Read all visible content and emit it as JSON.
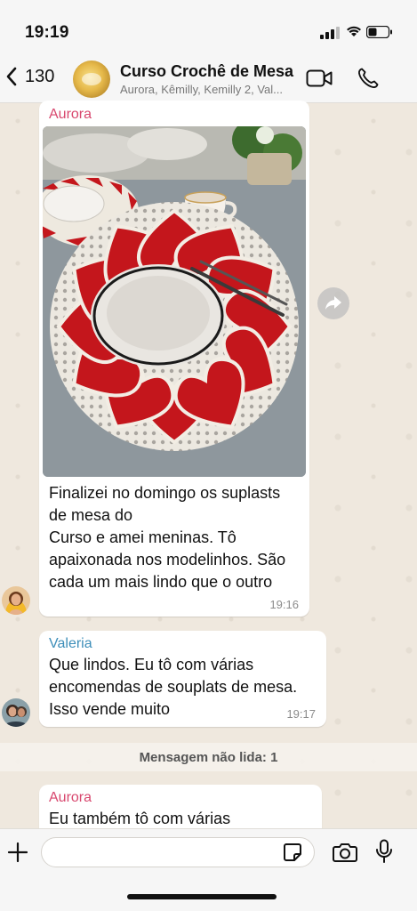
{
  "status_bar": {
    "time": "19:19"
  },
  "header": {
    "back_count": "130",
    "title": "Curso Crochê de Mesa",
    "members": "Aurora, Kêmilly, Kemilly 2, Val..."
  },
  "messages": [
    {
      "sender": "Aurora",
      "lines": [
        "Finalizei no domingo os suplasts",
        "de mesa do",
        "Curso e amei meninas. Tô",
        "apaixonada nos modelinhos. São",
        "cada um mais lindo que o outro"
      ],
      "time": "19:16"
    },
    {
      "sender": "Valeria",
      "lines": [
        "Que lindos. Eu tô com várias",
        "encomendas de souplats de mesa.",
        "Isso vende muito"
      ],
      "time": "19:17"
    },
    {
      "sender": "Aurora",
      "lines": [
        "Eu também tô com várias"
      ]
    }
  ],
  "unread_label": "Mensagem não lida: 1",
  "input": {
    "placeholder": ""
  },
  "colors": {
    "aurora_name": "#d8476e",
    "valeria_name": "#3d8eb9",
    "bubble": "#ffffff",
    "chat_background": "#efe8de"
  },
  "icons": {
    "back": "chevron-left-icon",
    "video": "video-camera-icon",
    "call": "phone-icon",
    "forward": "forward-arrow-icon",
    "plus": "plus-icon",
    "sticker": "sticker-icon",
    "camera": "camera-icon",
    "mic": "microphone-icon"
  }
}
